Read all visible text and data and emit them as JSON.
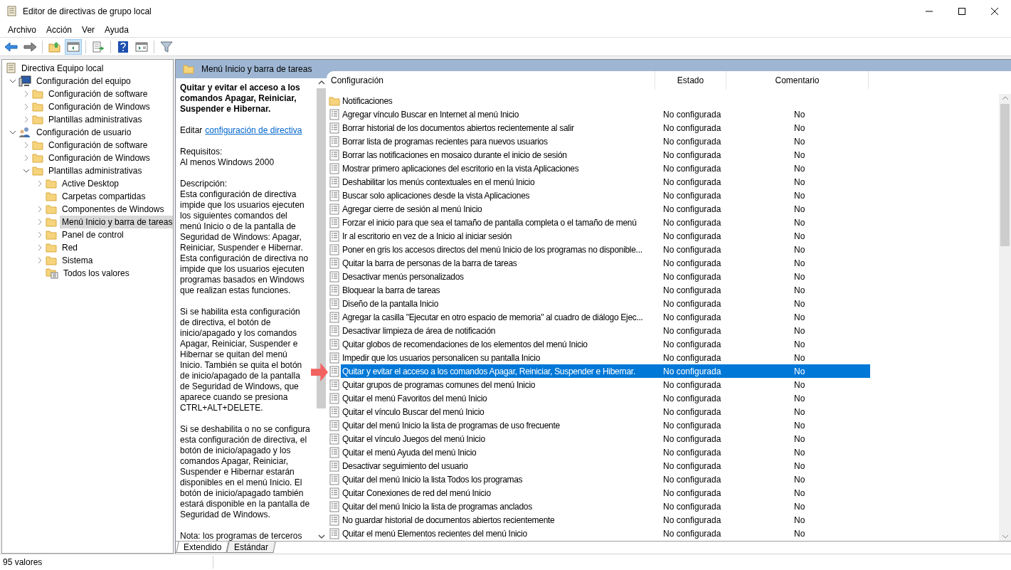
{
  "window": {
    "title": "Editor de directivas de grupo local"
  },
  "menu": [
    "Archivo",
    "Acción",
    "Ver",
    "Ayuda"
  ],
  "toolbar": [
    {
      "kind": "back",
      "pressed": false
    },
    {
      "kind": "forward",
      "pressed": false
    },
    {
      "kind": "up",
      "pressed": false
    },
    {
      "kind": "tree",
      "pressed": true
    },
    {
      "kind": "export",
      "pressed": false
    },
    {
      "kind": "help",
      "pressed": false
    },
    {
      "kind": "view",
      "pressed": false
    },
    {
      "kind": "filter",
      "pressed": false
    }
  ],
  "tree": [
    {
      "label": "Directiva Equipo local",
      "kind": "policy",
      "selected": false,
      "children": [
        {
          "label": "Configuración del equipo",
          "kind": "computer",
          "expandable": true,
          "expanded": true,
          "selected": false,
          "children": [
            {
              "label": "Configuración de software",
              "kind": "folder",
              "expandable": true,
              "expanded": false,
              "selected": false
            },
            {
              "label": "Configuración de Windows",
              "kind": "folder",
              "expandable": true,
              "expanded": false,
              "selected": false
            },
            {
              "label": "Plantillas administrativas",
              "kind": "folder",
              "expandable": true,
              "expanded": false,
              "selected": false
            }
          ]
        },
        {
          "label": "Configuración de usuario",
          "kind": "user",
          "expandable": true,
          "expanded": true,
          "selected": false,
          "children": [
            {
              "label": "Configuración de software",
              "kind": "folder",
              "expandable": true,
              "expanded": false,
              "selected": false
            },
            {
              "label": "Configuración de Windows",
              "kind": "folder",
              "expandable": true,
              "expanded": false,
              "selected": false
            },
            {
              "label": "Plantillas administrativas",
              "kind": "folder",
              "expandable": true,
              "expanded": true,
              "selected": false,
              "children": [
                {
                  "label": "Active Desktop",
                  "kind": "folder",
                  "expandable": true,
                  "expanded": false,
                  "selected": false
                },
                {
                  "label": "Carpetas compartidas",
                  "kind": "folder",
                  "expandable": false,
                  "selected": false
                },
                {
                  "label": "Componentes de Windows",
                  "kind": "folder",
                  "expandable": true,
                  "expanded": false,
                  "selected": false
                },
                {
                  "label": "Menú Inicio y barra de tareas",
                  "kind": "folder",
                  "expandable": true,
                  "expanded": false,
                  "selected": true
                },
                {
                  "label": "Panel de control",
                  "kind": "folder",
                  "expandable": true,
                  "expanded": false,
                  "selected": false
                },
                {
                  "label": "Red",
                  "kind": "folder",
                  "expandable": true,
                  "expanded": false,
                  "selected": false
                },
                {
                  "label": "Sistema",
                  "kind": "folder",
                  "expandable": true,
                  "expanded": false,
                  "selected": false
                },
                {
                  "label": "Todos los valores",
                  "kind": "all",
                  "expandable": false,
                  "selected": false
                }
              ]
            }
          ]
        }
      ]
    }
  ],
  "header": {
    "title": "Menú Inicio y barra de tareas"
  },
  "description": {
    "title": "Quitar y evitar el acceso a los comandos Apagar, Reiniciar, Suspender e Hibernar.",
    "edit_prefix": "Editar",
    "edit_link": "configuración de directiva",
    "paragraphs": [
      "Requisitos:\nAl menos Windows 2000",
      "Descripción:\nEsta configuración de directiva impide que los usuarios ejecuten los siguientes comandos del menú Inicio o de la pantalla de Seguridad de Windows: Apagar, Reiniciar, Suspender e Hibernar. Esta configuración de directiva no impide que los usuarios ejecuten programas basados en Windows que realizan estas funciones.",
      "Si se habilita esta configuración de directiva, el botón de inicio/apagado y los comandos Apagar, Reiniciar, Suspender e Hibernar se quitan del menú Inicio. También se quita el botón de inicio/apagado de la pantalla de Seguridad de Windows, que aparece cuando se presiona CTRL+ALT+DELETE.",
      "Si se deshabilita o no se configura esta configuración de directiva, el botón de inicio/apagado y los comandos Apagar, Reiniciar, Suspender e Hibernar estarán disponibles en el menú Inicio. El botón de inicio/apagado también estará disponible en la pantalla de Seguridad de Windows.",
      "Nota: los programas de terceros"
    ]
  },
  "table": {
    "columns": [
      "Configuración",
      "Estado",
      "Comentario"
    ],
    "rows": [
      {
        "kind": "folder",
        "name": "Notificaciones",
        "selected": false
      },
      {
        "kind": "setting",
        "name": "Agregar vínculo Buscar en Internet al menú Inicio",
        "state": "No configurada",
        "comment": "No",
        "selected": false
      },
      {
        "kind": "setting",
        "name": "Borrar historial de los documentos abiertos recientemente al salir",
        "state": "No configurada",
        "comment": "No",
        "selected": false
      },
      {
        "kind": "setting",
        "name": "Borrar lista de programas recientes para nuevos usuarios",
        "state": "No configurada",
        "comment": "No",
        "selected": false
      },
      {
        "kind": "setting",
        "name": "Borrar las notificaciones en mosaico durante el inicio de sesión",
        "state": "No configurada",
        "comment": "No",
        "selected": false
      },
      {
        "kind": "setting",
        "name": "Mostrar primero aplicaciones del escritorio en la vista Aplicaciones",
        "state": "No configurada",
        "comment": "No",
        "selected": false
      },
      {
        "kind": "setting",
        "name": "Deshabilitar los menús contextuales en el menú Inicio",
        "state": "No configurada",
        "comment": "No",
        "selected": false
      },
      {
        "kind": "setting",
        "name": "Buscar solo aplicaciones desde la vista Aplicaciones",
        "state": "No configurada",
        "comment": "No",
        "selected": false
      },
      {
        "kind": "setting",
        "name": "Agregar cierre de sesión al menú Inicio",
        "state": "No configurada",
        "comment": "No",
        "selected": false
      },
      {
        "kind": "setting",
        "name": "Forzar el inicio para que sea el tamaño de pantalla completa o el tamaño de menú",
        "state": "No configurada",
        "comment": "No",
        "selected": false
      },
      {
        "kind": "setting",
        "name": "Ir al escritorio en vez de a Inicio al iniciar sesión",
        "state": "No configurada",
        "comment": "No",
        "selected": false
      },
      {
        "kind": "setting",
        "name": "Poner en gris los accesos directos del menú Inicio de los programas no disponible...",
        "state": "No configurada",
        "comment": "No",
        "selected": false
      },
      {
        "kind": "setting",
        "name": "Quitar la barra de personas de la barra de tareas",
        "state": "No configurada",
        "comment": "No",
        "selected": false
      },
      {
        "kind": "setting",
        "name": "Desactivar menús personalizados",
        "state": "No configurada",
        "comment": "No",
        "selected": false
      },
      {
        "kind": "setting",
        "name": "Bloquear la barra de tareas",
        "state": "No configurada",
        "comment": "No",
        "selected": false
      },
      {
        "kind": "setting",
        "name": "Diseño de la pantalla Inicio",
        "state": "No configurada",
        "comment": "No",
        "selected": false
      },
      {
        "kind": "setting",
        "name": "Agregar la casilla \"Ejecutar en otro espacio de memoria\" al cuadro de diálogo Ejec...",
        "state": "No configurada",
        "comment": "No",
        "selected": false
      },
      {
        "kind": "setting",
        "name": "Desactivar limpieza de área de notificación",
        "state": "No configurada",
        "comment": "No",
        "selected": false
      },
      {
        "kind": "setting",
        "name": "Quitar globos de recomendaciones de los elementos del menú Inicio",
        "state": "No configurada",
        "comment": "No",
        "selected": false
      },
      {
        "kind": "setting",
        "name": "Impedir que los usuarios personalicen su pantalla Inicio",
        "state": "No configurada",
        "comment": "No",
        "selected": false
      },
      {
        "kind": "setting",
        "name": "Quitar y evitar el acceso a los comandos Apagar, Reiniciar, Suspender e Hibernar.",
        "state": "No configurada",
        "comment": "No",
        "selected": true
      },
      {
        "kind": "setting",
        "name": "Quitar grupos de programas comunes del menú Inicio",
        "state": "No configurada",
        "comment": "No",
        "selected": false
      },
      {
        "kind": "setting",
        "name": "Quitar el menú Favoritos del menú Inicio",
        "state": "No configurada",
        "comment": "No",
        "selected": false
      },
      {
        "kind": "setting",
        "name": "Quitar el vínculo Buscar del menú Inicio",
        "state": "No configurada",
        "comment": "No",
        "selected": false
      },
      {
        "kind": "setting",
        "name": "Quitar del menú Inicio la lista de programas de uso frecuente",
        "state": "No configurada",
        "comment": "No",
        "selected": false
      },
      {
        "kind": "setting",
        "name": "Quitar el vínculo Juegos del menú Inicio",
        "state": "No configurada",
        "comment": "No",
        "selected": false
      },
      {
        "kind": "setting",
        "name": "Quitar el menú Ayuda del menú Inicio",
        "state": "No configurada",
        "comment": "No",
        "selected": false
      },
      {
        "kind": "setting",
        "name": "Desactivar seguimiento del usuario",
        "state": "No configurada",
        "comment": "No",
        "selected": false
      },
      {
        "kind": "setting",
        "name": "Quitar del menú Inicio la lista Todos los programas",
        "state": "No configurada",
        "comment": "No",
        "selected": false
      },
      {
        "kind": "setting",
        "name": "Quitar Conexiones de red del menú Inicio",
        "state": "No configurada",
        "comment": "No",
        "selected": false
      },
      {
        "kind": "setting",
        "name": "Quitar del menú Inicio la lista de programas anclados",
        "state": "No configurada",
        "comment": "No",
        "selected": false
      },
      {
        "kind": "setting",
        "name": "No guardar historial de documentos abiertos recientemente",
        "state": "No configurada",
        "comment": "No",
        "selected": false
      },
      {
        "kind": "setting",
        "name": "Quitar el menú Elementos recientes del menú Inicio",
        "state": "No configurada",
        "comment": "No",
        "selected": false
      }
    ]
  },
  "view_tabs": [
    {
      "label": "Extendido",
      "selected": true
    },
    {
      "label": "Estándar",
      "selected": false
    }
  ],
  "status_bar": {
    "text": "95 valores"
  }
}
